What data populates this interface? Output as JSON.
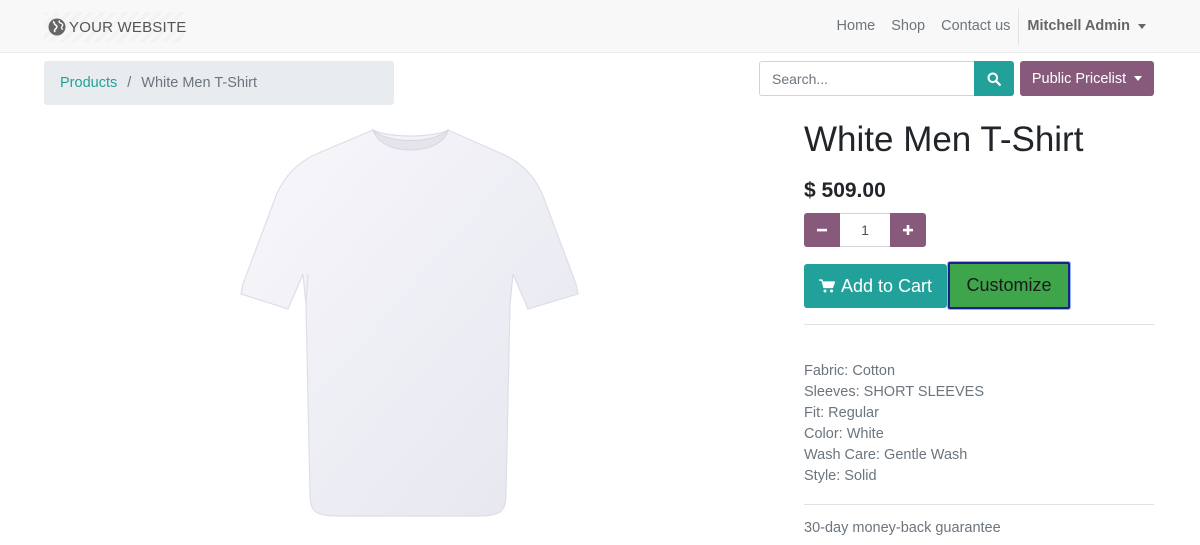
{
  "navbar": {
    "brand": "YOUR WEBSITE",
    "links": [
      "Home",
      "Shop",
      "Contact us"
    ],
    "user": "Mitchell Admin"
  },
  "breadcrumb": {
    "parent": "Products",
    "divider": "/",
    "current": "White Men T-Shirt"
  },
  "search": {
    "placeholder": "Search..."
  },
  "pricelist": {
    "label": "Public Pricelist"
  },
  "product": {
    "name": "White Men T-Shirt",
    "price": "$ 509.00",
    "quantity": "1",
    "add_to_cart": "Add to Cart",
    "customize": "Customize",
    "specs": [
      "Fabric: Cotton",
      "Sleeves: SHORT SLEEVES",
      "Fit: Regular",
      "Color: White",
      "Wash Care: Gentle Wash",
      "Style: Solid"
    ],
    "guarantee": "30-day money-back guarantee"
  },
  "colors": {
    "primary": "#21a19a",
    "secondary": "#875a7b",
    "customize": "#3fa54b"
  },
  "icons": {
    "brand": "globe-icon",
    "search": "search-icon",
    "cart": "shopping-cart-icon",
    "minus": "minus-icon",
    "plus": "plus-icon"
  }
}
